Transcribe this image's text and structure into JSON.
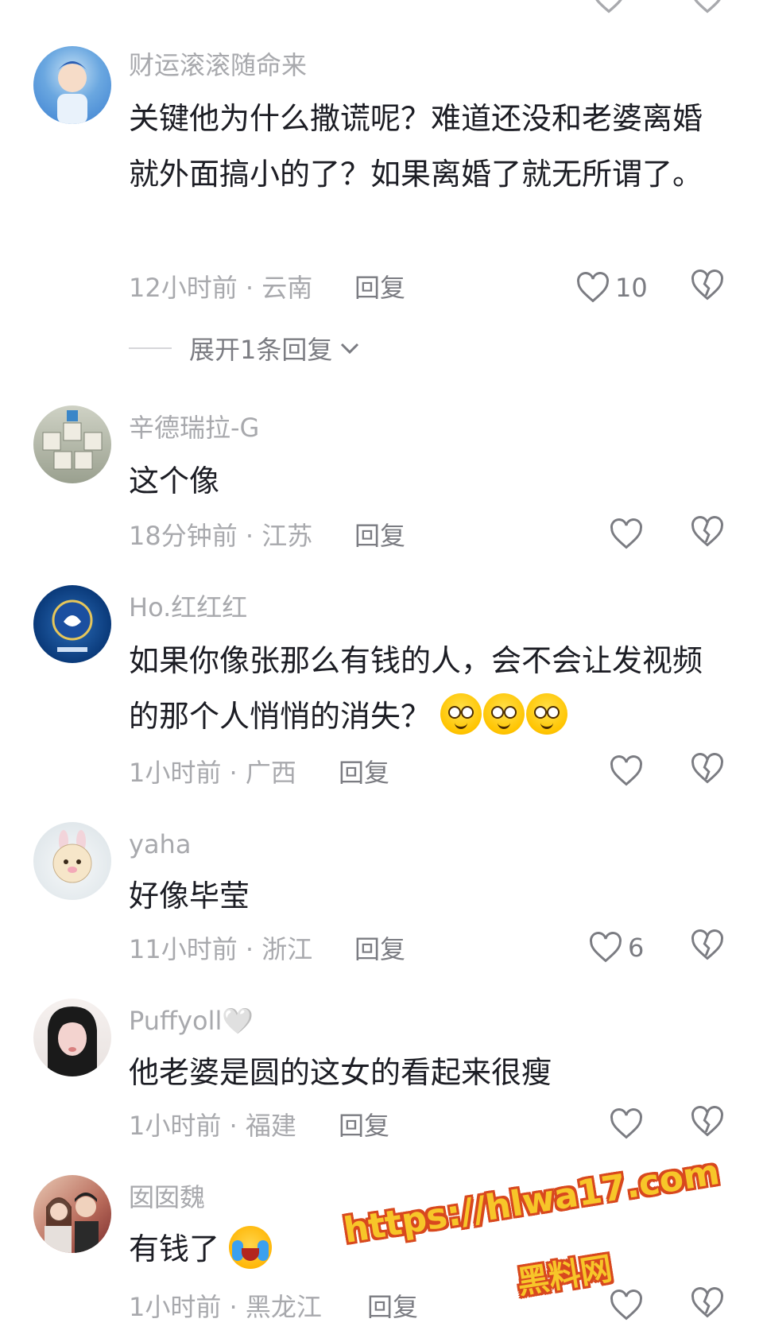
{
  "comments": [
    {
      "username": "财运滚滚随命来",
      "text": "关键他为什么撒谎呢？难道还没和老婆离婚就外面搞小的了？如果离婚了就无所谓了。",
      "meta": "12小时前 · 云南",
      "reply": "回复",
      "likes": "10",
      "expand": "展开1条回复",
      "avatar_colors": [
        "#3b7fd1",
        "#c9e3f6"
      ]
    },
    {
      "username": "辛德瑞拉-G",
      "text": "这个像",
      "meta": "18分钟前 · 江苏",
      "reply": "回复",
      "likes": "",
      "avatar_colors": [
        "#9aa08f",
        "#e7e4da"
      ]
    },
    {
      "username": "Ho.红红红",
      "text": "如果你像张那么有钱的人，会不会让发视频的那个人悄悄的消失？",
      "meta": "1小时前 · 广西",
      "reply": "回复",
      "likes": "",
      "avatar_colors": [
        "#0a3a7a",
        "#2b6cb8"
      ]
    },
    {
      "username": "yaha",
      "text": "好像毕莹",
      "meta": "11小时前 · 浙江",
      "reply": "回复",
      "likes": "6",
      "avatar_colors": [
        "#dfe6ea",
        "#f2d4da"
      ]
    },
    {
      "username": "Puffyoll🤍",
      "text": "他老婆是圆的这女的看起来很瘦",
      "meta": "1小时前 · 福建",
      "reply": "回复",
      "likes": "",
      "avatar_colors": [
        "#1a1a1a",
        "#f3d3cf"
      ]
    },
    {
      "username": "囡囡魏",
      "text": "有钱了",
      "meta": "1小时前 · 黑龙江",
      "reply": "回复",
      "likes": "",
      "avatar_colors": [
        "#7a2c2c",
        "#e9c9b4"
      ]
    }
  ],
  "watermark": {
    "url": "https://hlwa17.com",
    "name": "黑料网"
  },
  "icons": {
    "like": "heart-outline-icon",
    "dislike": "broken-heart-icon",
    "expand": "chevron-down-icon"
  },
  "colors": {
    "muted_text": "#a8a9ad",
    "body_text": "#1c1d24",
    "action_text": "#7b7c82",
    "watermark_fill": "#f7c629",
    "watermark_stroke": "#d8481e"
  }
}
